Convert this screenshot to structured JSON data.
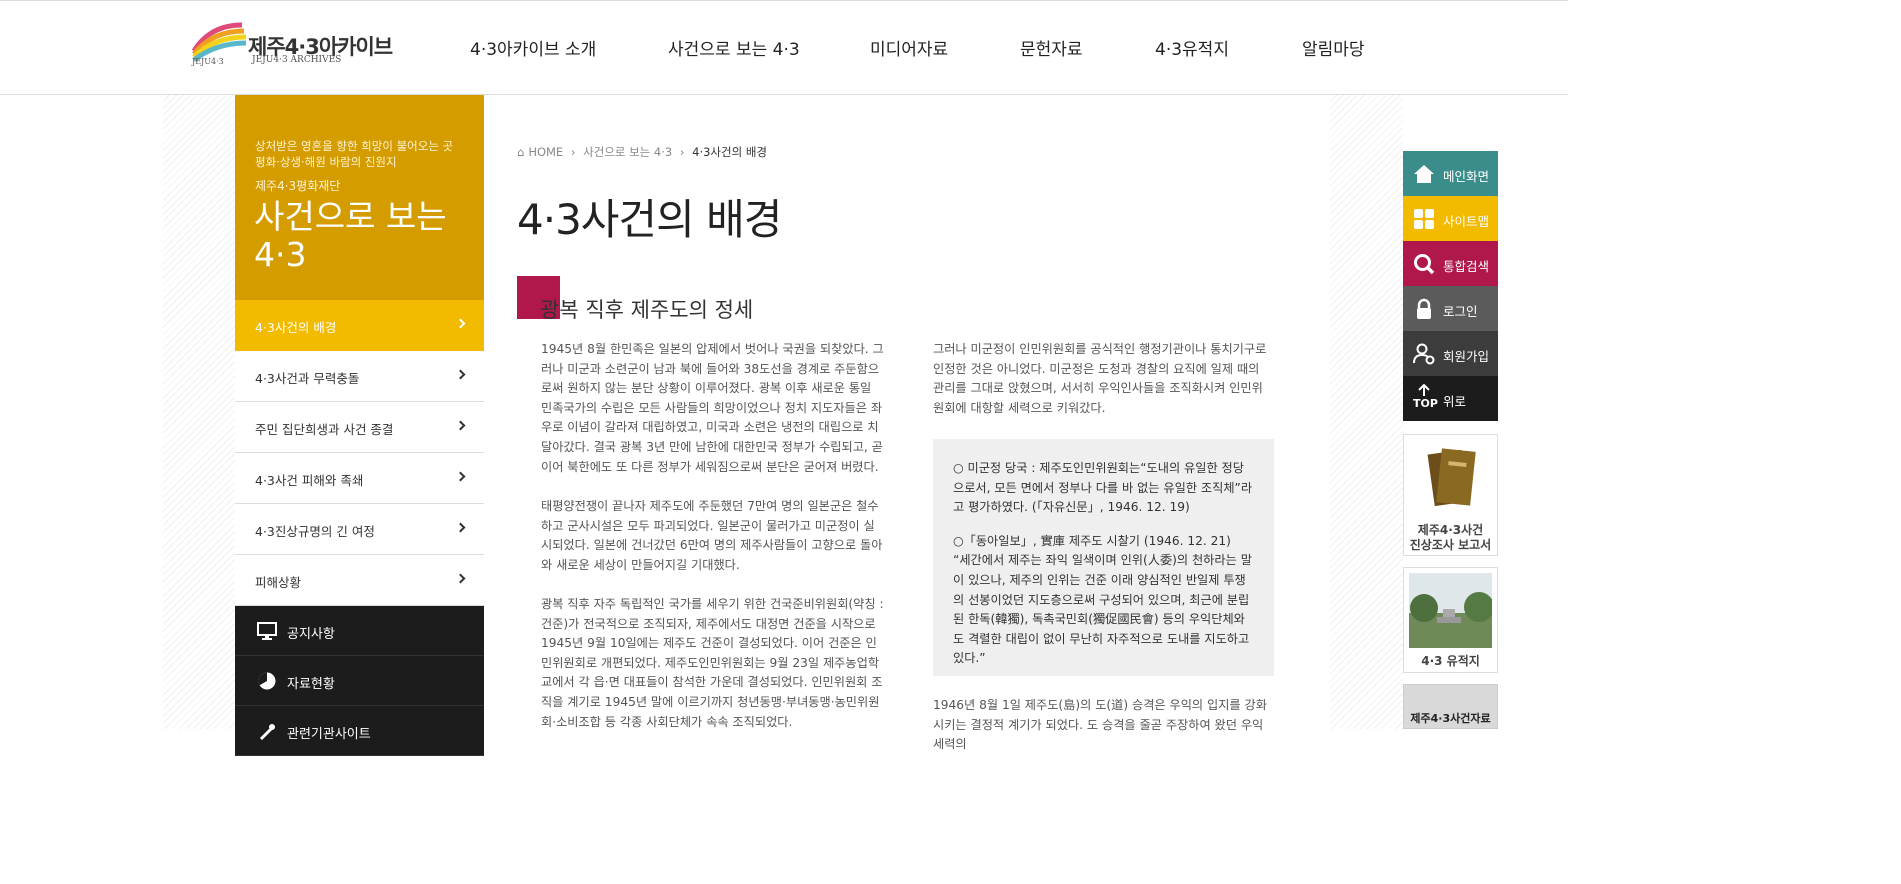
{
  "brand": {
    "title": "제주4·3아카이브",
    "subtitle": "JEJU4·3 ARCHIVES",
    "mark_text": "JEJU4·3"
  },
  "nav": [
    {
      "label": "4·3아카이브 소개"
    },
    {
      "label": "사건으로 보는 4·3"
    },
    {
      "label": "미디어자료"
    },
    {
      "label": "문헌자료"
    },
    {
      "label": "4·3유적지"
    },
    {
      "label": "알림마당"
    }
  ],
  "sidebar": {
    "slogan_1": "상처받은 영혼을 향한 희망이 불어오는 곳",
    "slogan_2": "평화·상생·해원 바람의 진원지",
    "org": "제주4·3평화재단",
    "title_1": "사건으로 보는",
    "title_2": "4·3",
    "items": [
      {
        "label": "4·3사건의 배경",
        "active": true
      },
      {
        "label": "4·3사건과 무력충돌"
      },
      {
        "label": "주민 집단희생과 사건 종결"
      },
      {
        "label": "4·3사건 피해와 족쇄"
      },
      {
        "label": "4·3진상규명의 긴 여정"
      },
      {
        "label": "피해상황"
      }
    ],
    "dark_items": [
      {
        "label": "공지사항",
        "icon": "monitor-icon"
      },
      {
        "label": "자료현황",
        "icon": "pie-chart-icon"
      },
      {
        "label": "관련기관사이트",
        "icon": "link-icon"
      }
    ]
  },
  "breadcrumb": {
    "home": "HOME",
    "level1": "사건으로 보는 4·3",
    "current": "4·3사건의 배경"
  },
  "content": {
    "title": "4·3사건의 배경",
    "section_title": "광복 직후 제주도의 정세",
    "left_paragraphs": [
      "1945년 8월 한민족은 일본의 압제에서 벗어나 국권을 되찾았다. 그러나 미군과 소련군이 남과 북에 들어와 38도선을 경계로 주둔함으로써 원하지 않는 분단 상황이 이루어졌다. 광복 이후 새로운 통일 민족국가의 수립은 모든 사람들의 희망이었으나 정치 지도자들은 좌우로 이념이 갈라져 대립하였고, 미국과 소련은 냉전의 대립으로 치달아갔다. 결국 광복 3년 만에 남한에 대한민국 정부가 수립되고, 곧이어 북한에도 또 다른 정부가 세워짐으로써 분단은 굳어져 버렸다.",
      "태평양전쟁이 끝나자 제주도에 주둔했던 7만여 명의 일본군은 철수하고 군사시설은 모두 파괴되었다. 일본군이 물러가고 미군정이 실시되었다. 일본에 건너갔던 6만여 명의 제주사람들이 고향으로 돌아와 새로운 세상이 만들어지길 기대했다.",
      "광복 직후 자주 독립적인 국가를 세우기 위한 건국준비위원회(약칭 : 건준)가 전국적으로 조직되자, 제주에서도 대정면 건준을 시작으로 1945년 9월 10일에는 제주도 건준이 결성되었다. 이어 건준은 인민위원회로 개편되었다. 제주도인민위원회는 9월 23일 제주농업학교에서 각 읍·면 대표들이 참석한 가운데 결성되었다. 인민위원회 조직을 계기로 1945년 말에 이르기까지 청년동맹·부녀동맹·농민위원회·소비조합 등 각종 사회단체가 속속 조직되었다."
    ],
    "right_paragraph_1": "그러나 미군정이 인민위원회를 공식적인 행정기관이나 통치기구로 인정한 것은 아니었다. 미군정은 도청과 경찰의 요직에 일제 때의 관리를 그대로 앉혔으며, 서서히 우익인사들을 조직화시켜 인민위원회에 대항할 세력으로 키워갔다.",
    "quote_1": "○ 미군정 당국 : 제주도인민위원회는“도내의 유일한 정당으로서, 모든 면에서 정부나 다를 바 없는 유일한 조직체”라고 평가하였다. (「자유신문」, 1946. 12. 19)",
    "quote_2_head": "○「동아일보」, 實庫 제주도 시찰기 (1946. 12. 21)",
    "quote_2_body": "“세간에서 제주는 좌익 일색이며 인위(人委)의 천하라는 말이 있으나, 제주의 인위는 건준 이래 양심적인 반일제 투쟁의 선봉이었던 지도층으로써 구성되어 있으며, 최근에 분립된 한독(韓獨), 독촉국민회(獨促國民會) 등의 우익단체와도 격렬한 대립이 없이 무난히 자주적으로 도내를 지도하고 있다.”",
    "right_paragraph_2": "1946년 8월 1일 제주도(島)의 도(道) 승격은 우익의 입지를 강화시키는 결정적 계기가 되었다. 도 승격을 줄곧 주장하여 왔던 우익세력의"
  },
  "quick_menu": [
    {
      "label": "메인화면",
      "icon": "home-icon",
      "color": "#3b8d8c"
    },
    {
      "label": "사이트맵",
      "icon": "sitemap-icon",
      "color": "#f2bb00"
    },
    {
      "label": "통합검색",
      "icon": "search-icon",
      "color": "#b0174b"
    },
    {
      "label": "로그인",
      "icon": "lock-icon",
      "color": "#5b5b5b"
    },
    {
      "label": "회원가입",
      "icon": "user-add-icon",
      "color": "#3c3c3c"
    },
    {
      "label": "위로",
      "icon": "top-arrow-icon",
      "color": "#1c1c1c",
      "sub": "TOP"
    }
  ],
  "banners": [
    {
      "label_1": "제주4·3사건",
      "label_2": "진상조사 보고서",
      "icon": "report-book-icon"
    },
    {
      "label_1": "4·3 유적지",
      "icon": "memorial-site-icon"
    },
    {
      "label_1": "제주4·3사건자료",
      "icon": "document-icon"
    }
  ],
  "colors": {
    "sidebar_head": "#d59c00",
    "sidebar_active": "#f2bb00",
    "section_accent": "#b0174b",
    "dark_menu": "#1c1c1c"
  }
}
